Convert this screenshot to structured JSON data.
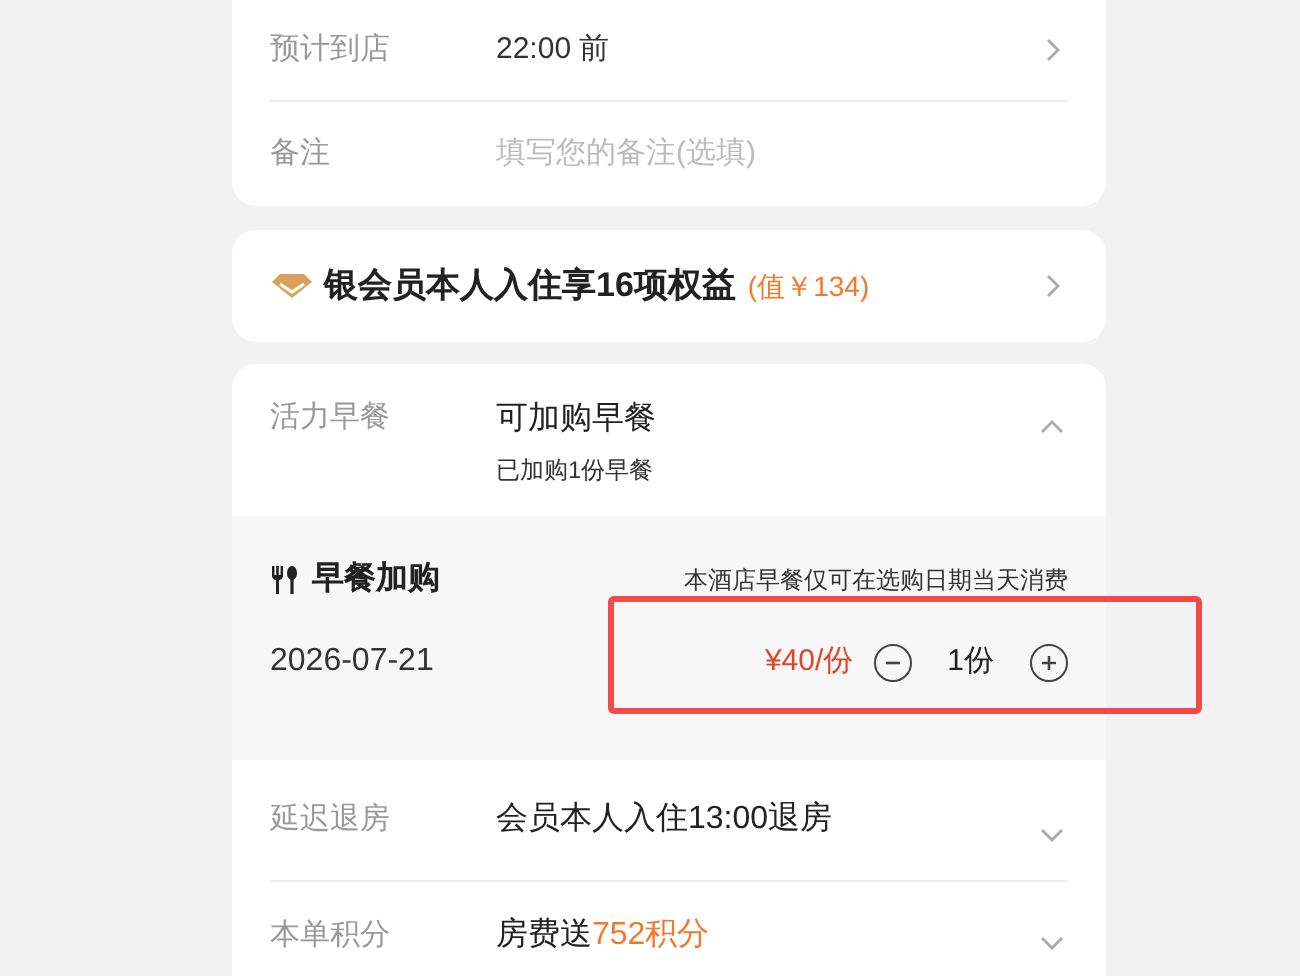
{
  "info_rows": [
    {
      "label": "预计到店",
      "value": "22:00 前",
      "kind": "chevron"
    },
    {
      "label": "备注",
      "placeholder": "填写您的备注(选填)",
      "kind": "input"
    }
  ],
  "member_benefit": {
    "text": "银会员本人入住享16项权益",
    "worth": "(值￥134)"
  },
  "breakfast": {
    "label": "活力早餐",
    "value": "可加购早餐",
    "note": "已加购1份早餐",
    "expanded": true
  },
  "addon": {
    "title": "早餐加购",
    "notice": "本酒店早餐仅可在选购日期当天消费",
    "date": "2026-07-21",
    "price": "¥40/份",
    "quantity": "1份"
  },
  "extra_rows": [
    {
      "label": "延迟退房",
      "value": "会员本人入住13:00退房",
      "expanded": false
    },
    {
      "label": "本单积分",
      "value": "房费送",
      "highlight": "752积分",
      "expanded": false
    }
  ]
}
